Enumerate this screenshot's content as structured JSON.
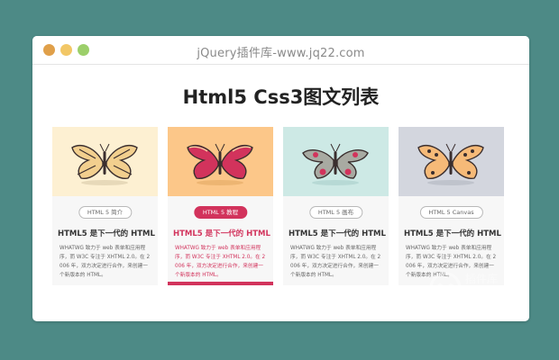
{
  "window": {
    "title": "jQuery插件库-www.jq22.com",
    "buttons": [
      {
        "name": "close",
        "color": "#e0a04a"
      },
      {
        "name": "minimize",
        "color": "#f2c766"
      },
      {
        "name": "maximize",
        "color": "#9ccf6a"
      }
    ]
  },
  "page": {
    "title": "Html5 Css3图文列表"
  },
  "cards": [
    {
      "tag": "HTML 5 简介",
      "title": "HTML5 是下一代的 HTML",
      "desc": "WHATWG 致力于 web 表单和应用程序，而 W3C 专注于 XHTML 2.0。在 2006 年，双方决定进行合作，来创建一个新版本的 HTML。",
      "bg": "#fdf0d2",
      "icon": "butterfly-icon"
    },
    {
      "tag": "HTML 5 教程",
      "title": "HTML5 是下一代的 HTML",
      "desc": "WHATWG 致力于 web 表单和应用程序，而 W3C 专注于 XHTML 2.0。在 2006 年，双方决定进行合作，来创建一个新版本的 HTML。",
      "bg": "#fcc789",
      "icon": "butterfly-icon",
      "active": true
    },
    {
      "tag": "HTML 5 画布",
      "title": "HTML5 是下一代的 HTML",
      "desc": "WHATWG 致力于 web 表单和应用程序，而 W3C 专注于 XHTML 2.0。在 2006 年，双方决定进行合作，来创建一个新版本的 HTML。",
      "bg": "#cde9e5",
      "icon": "moth-icon"
    },
    {
      "tag": "HTML 5 Canvas",
      "title": "HTML5 是下一代的 HTML",
      "desc": "WHATWG 致力于 web 表单和应用程序，而 W3C 专注于 XHTML 2.0。在 2006 年，双方决定进行合作，来创建一个新版本的 HTML。",
      "bg": "#d3d6de",
      "icon": "butterfly-icon"
    }
  ],
  "watermark": {
    "brand": "jQuery",
    "cn": "插件库"
  },
  "colors": {
    "background": "#4d8a86",
    "accent": "#d2335c",
    "wing_1": "#f2cf8e",
    "wing_2": "#d2335c",
    "wing_3": "#a8aaa2",
    "wing_4": "#f6ba78"
  }
}
